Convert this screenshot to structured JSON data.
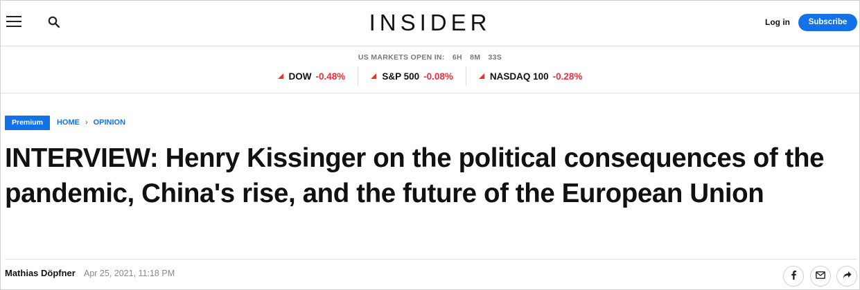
{
  "header": {
    "logo": "INSIDER",
    "login_label": "Log in",
    "subscribe_label": "Subscribe"
  },
  "markets": {
    "status_label": "US MARKETS OPEN IN:",
    "countdown": [
      "6H",
      "8M",
      "33S"
    ],
    "tickers": [
      {
        "name": "DOW",
        "change": "-0.48%"
      },
      {
        "name": "S&P 500",
        "change": "-0.08%"
      },
      {
        "name": "NASDAQ 100",
        "change": "-0.28%"
      }
    ],
    "down_color": "#e6323c"
  },
  "article": {
    "badge": "Premium",
    "breadcrumb": [
      "HOME",
      "OPINION"
    ],
    "headline": "INTERVIEW: Henry Kissinger on the political consequences of the pandemic, China's rise, and the future of the European Union",
    "author": "Mathias Döpfner",
    "date": "Apr 25, 2021, 11:18 PM"
  },
  "share_icons": [
    "facebook-icon",
    "email-icon",
    "share-icon"
  ],
  "colors": {
    "accent": "#1372e8"
  }
}
